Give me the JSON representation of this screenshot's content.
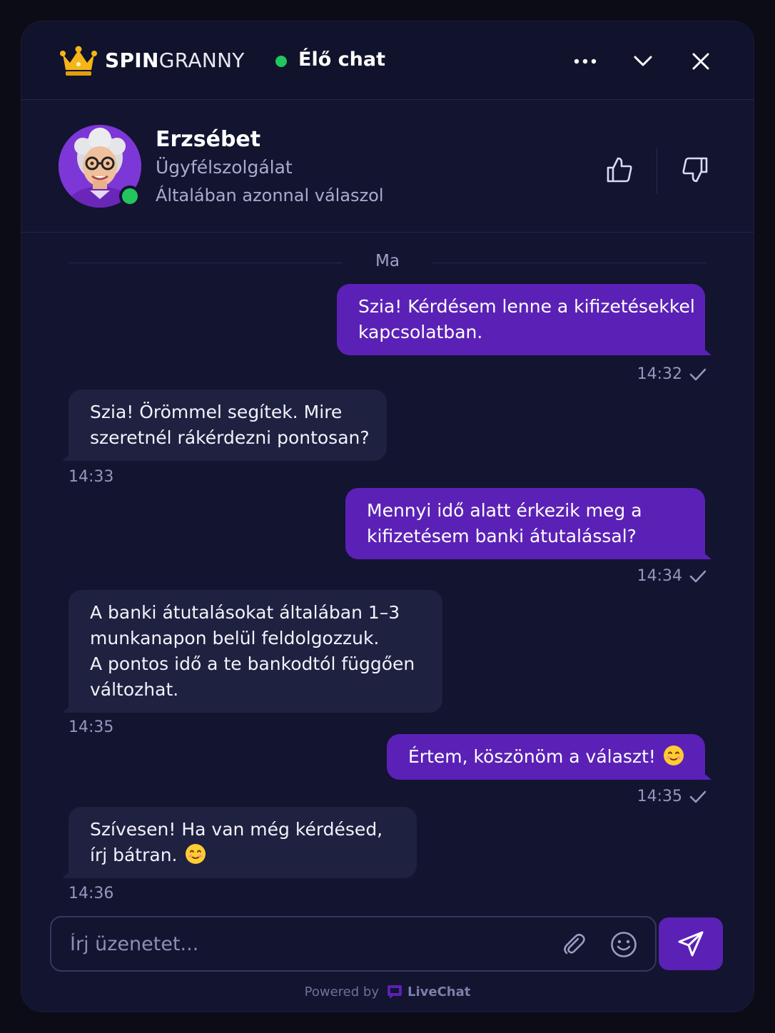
{
  "header": {
    "brand_bold": "SPIN",
    "brand_rest": "GRANNY",
    "status_label": "Élő chat",
    "icons": [
      "crown-icon",
      "more-icon",
      "chevron-down-icon",
      "close-icon"
    ],
    "status_color": "#22c55e"
  },
  "agent": {
    "name": "Erzsébet",
    "role": "Ügyfélszolgálat",
    "response_note": "Általában azonnal válaszol",
    "online": true
  },
  "conversation": {
    "day_label": "Ma",
    "messages": [
      {
        "from": "user",
        "text_lines": [
          "Szia! Kérdésem lenne a kifizetésekkel",
          "kapcsolatban."
        ],
        "time": "14:32"
      },
      {
        "from": "agent",
        "text_lines": [
          "Szia! Örömmel segítek. Mire",
          "szeretnél rákérdezni pontosan?"
        ],
        "time": "14:33"
      },
      {
        "from": "user",
        "text_lines": [
          "Mennyi idő alatt érkezik meg a",
          "kifizetésem banki átutalással?"
        ],
        "time": "14:34"
      },
      {
        "from": "agent",
        "text_lines": [
          "A banki átutalásokat általában 1–3",
          "munkanapon belül feldolgozzuk.",
          "A pontos idő a te bankodtól függően",
          "változhat."
        ],
        "time": "14:35"
      },
      {
        "from": "user",
        "text_lines": [
          "Értem, köszönöm a választ!"
        ],
        "emoji": "smile-emoji",
        "time": "14:35"
      },
      {
        "from": "agent",
        "text_lines": [
          "Szívesen! Ha van még kérdésed,",
          "írj bátran."
        ],
        "emoji": "smile-emoji",
        "time": "14:36"
      }
    ]
  },
  "composer": {
    "placeholder": "Írj üzenetet...",
    "value": ""
  },
  "footer": {
    "powered_by": "Powered by",
    "provider": "LiveChat"
  },
  "colors": {
    "accent": "#5b21b6",
    "background": "#121430",
    "incoming_bubble": "#1e2140",
    "online": "#22c55e",
    "crown": "#f5b519"
  }
}
